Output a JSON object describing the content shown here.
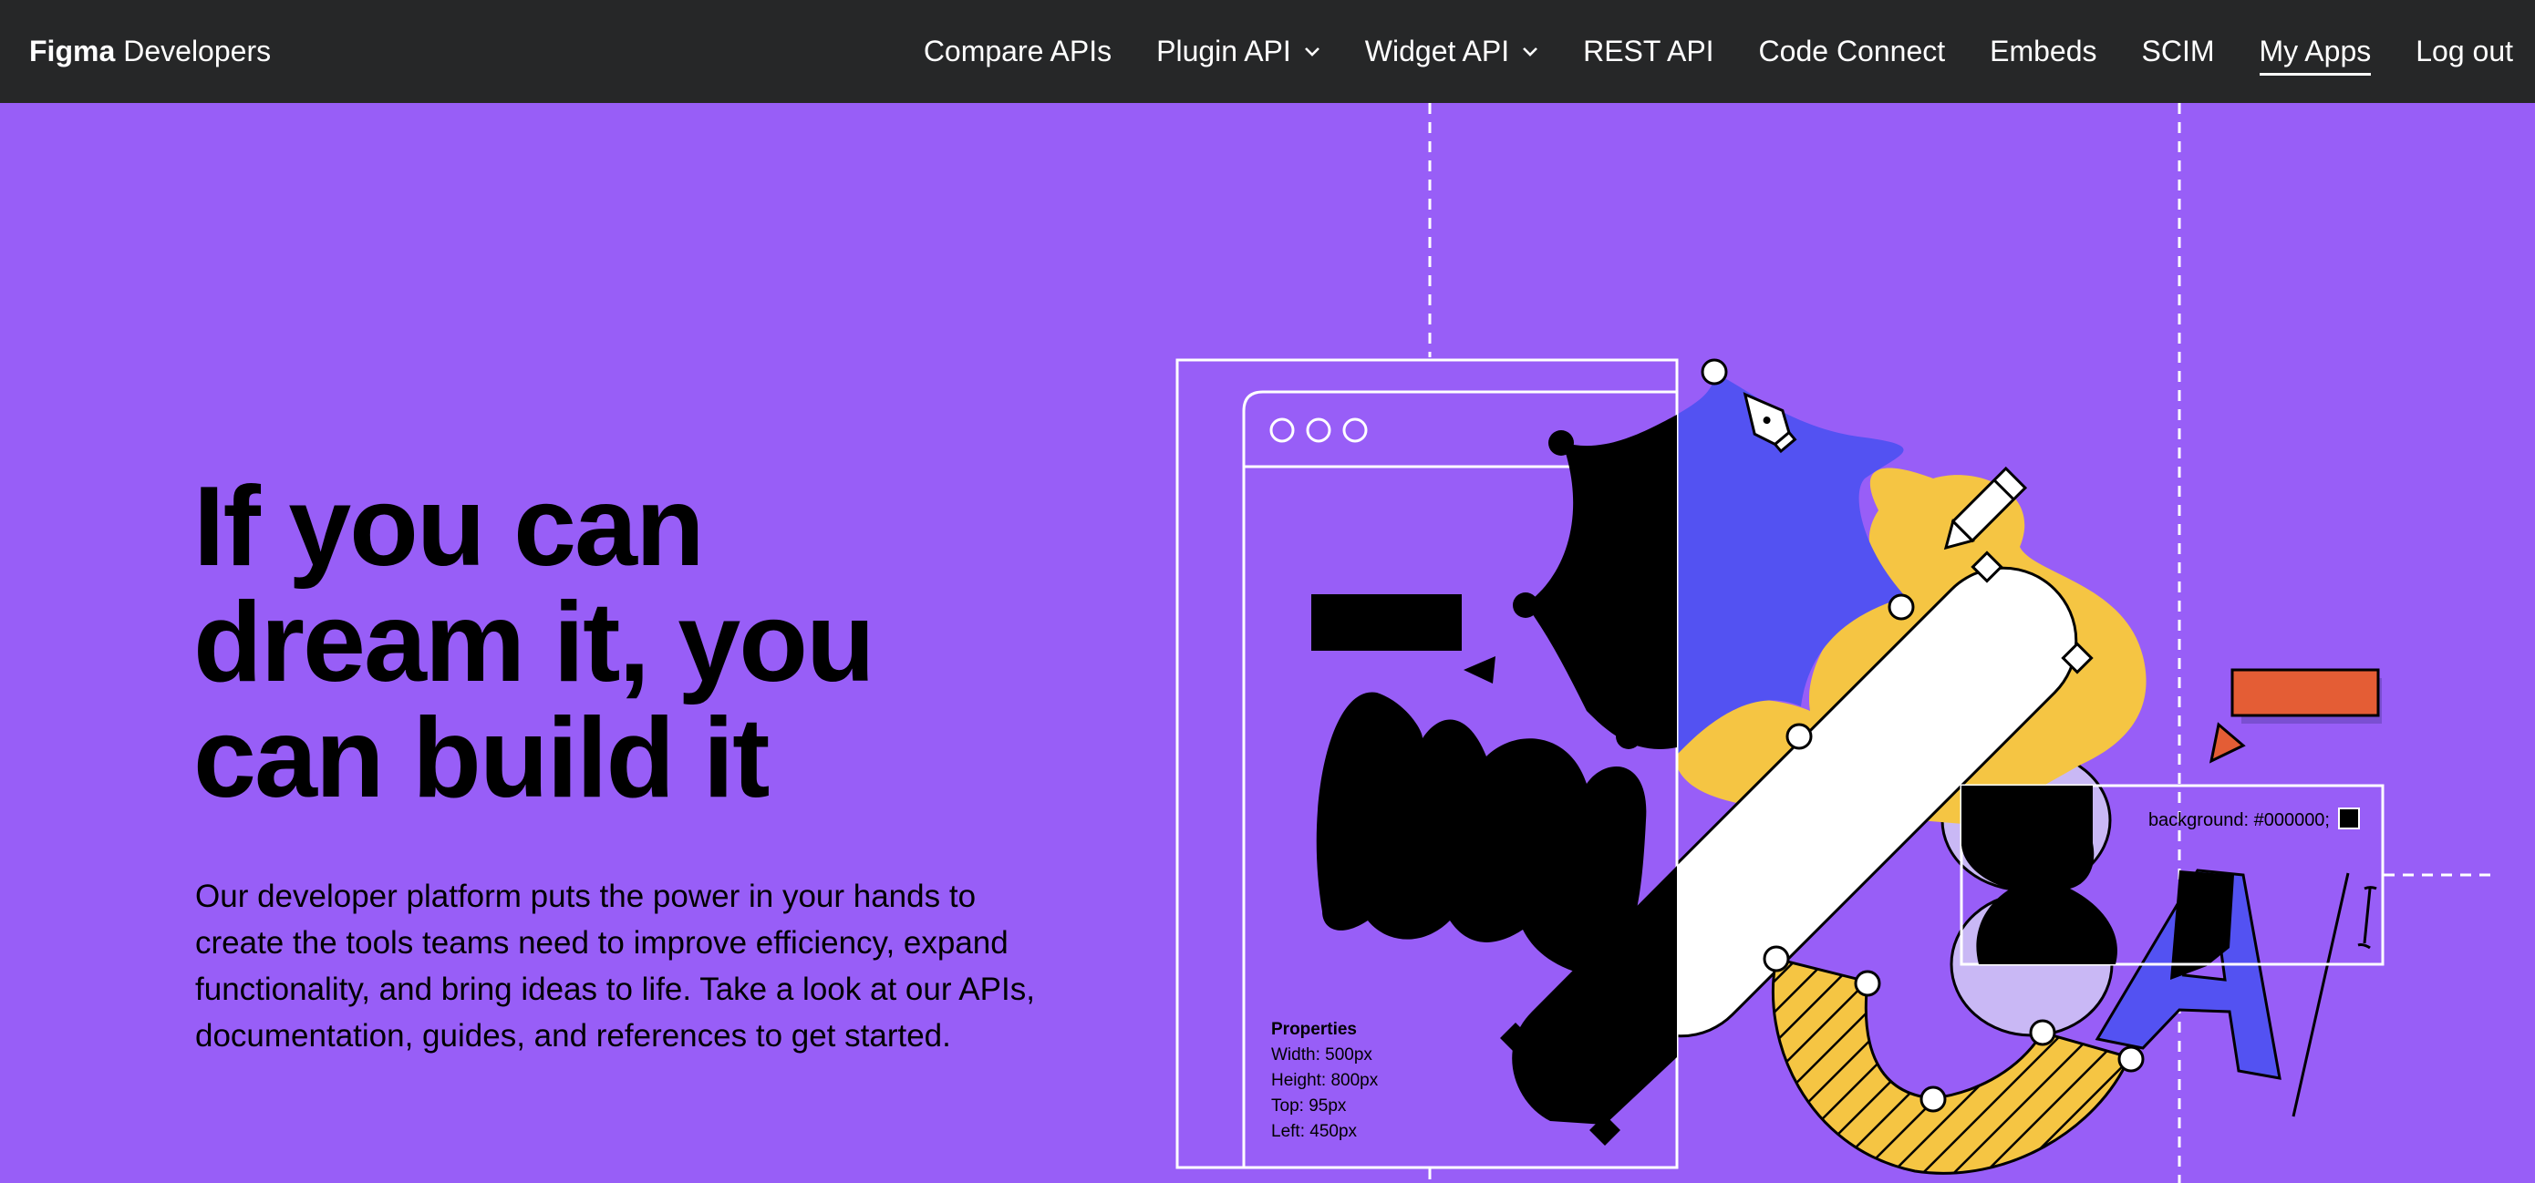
{
  "nav": {
    "brand_bold": "Figma",
    "brand_rest": "Developers",
    "items": [
      {
        "label": "Compare APIs",
        "dropdown": false
      },
      {
        "label": "Plugin API",
        "dropdown": true
      },
      {
        "label": "Widget API",
        "dropdown": true
      },
      {
        "label": "REST API",
        "dropdown": false
      },
      {
        "label": "Code Connect",
        "dropdown": false
      },
      {
        "label": "Embeds",
        "dropdown": false
      },
      {
        "label": "SCIM",
        "dropdown": false
      },
      {
        "label": "My Apps",
        "dropdown": false,
        "active": true
      },
      {
        "label": "Log out",
        "dropdown": false
      }
    ]
  },
  "hero": {
    "title_lines": [
      "If you can",
      "dream it, you",
      "can build it"
    ],
    "description": "Our developer platform puts the power in your hands to create the tools teams need to improve efficiency, expand functionality, and bring ideas to life. Take a look at our APIs, documentation, guides, and references to get started."
  },
  "illustration": {
    "properties_title": "Properties",
    "properties_lines": [
      "Width: 500px",
      "Height: 800px",
      "Top: 95px",
      "Left: 450px"
    ],
    "background_label": "background: #000000;",
    "letter": "A"
  },
  "colors": {
    "page_bg": "#985ef7",
    "topbar_bg": "#262728",
    "blue": "#5352f2",
    "yellow": "#f5c543",
    "lilac": "#c9b8f5",
    "orange": "#e45d35"
  }
}
